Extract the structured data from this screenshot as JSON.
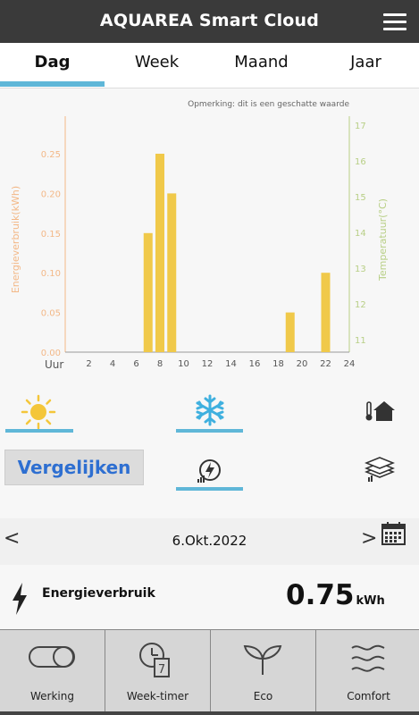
{
  "header": {
    "title": "AQUAREA Smart Cloud",
    "menu_icon": "hamburger-menu-icon"
  },
  "tabs": [
    {
      "label": "Dag",
      "active": true
    },
    {
      "label": "Week",
      "active": false
    },
    {
      "label": "Maand",
      "active": false
    },
    {
      "label": "Jaar",
      "active": false
    }
  ],
  "note": "Opmerking: dit is een geschatte waarde",
  "chart_data": {
    "type": "bar",
    "x_axis_label": "Uur",
    "ylabel_left": "Energieverbruik(kWh)",
    "ylabel_right": "Temperatuur(°C)",
    "x_ticks": [
      2,
      4,
      6,
      8,
      10,
      12,
      14,
      16,
      18,
      20,
      22,
      24
    ],
    "left_ticks": [
      "0.00",
      "0.05",
      "0.10",
      "0.15",
      "0.20",
      "0.25"
    ],
    "right_ticks": [
      11,
      12,
      13,
      14,
      15,
      16,
      17
    ],
    "ylim_left": [
      0,
      0.25
    ],
    "ylim_right": [
      11,
      17
    ],
    "xlim": [
      0,
      24
    ],
    "bars": [
      {
        "hour": 7,
        "value": 0.15
      },
      {
        "hour": 8,
        "value": 0.25
      },
      {
        "hour": 9,
        "value": 0.2
      },
      {
        "hour": 19,
        "value": 0.05
      },
      {
        "hour": 22,
        "value": 0.1
      }
    ],
    "bar_color": "#f0c94a",
    "left_axis_color": "#f3b887",
    "right_axis_color": "#b8cf86"
  },
  "mode_icons": {
    "heating": "sun-icon",
    "cooling": "snowflake-icon",
    "tank": "house-thermometer-icon",
    "energy": "energy-gauge-icon",
    "floors": "layers-icon"
  },
  "compare_label": "Vergelijken",
  "date": {
    "prev": "<",
    "value": "6.Okt.2022",
    "next": ">",
    "calendar_icon": "calendar-icon"
  },
  "energy": {
    "label": "Energieverbruik",
    "value": "0.75",
    "unit": "kWh",
    "icon": "lightning-icon"
  },
  "bottom_nav": [
    {
      "label": "Werking",
      "icon": "toggle-icon"
    },
    {
      "label": "Week-timer",
      "icon": "timer-icon"
    },
    {
      "label": "Eco",
      "icon": "sprout-icon"
    },
    {
      "label": "Comfort",
      "icon": "waves-icon"
    }
  ]
}
